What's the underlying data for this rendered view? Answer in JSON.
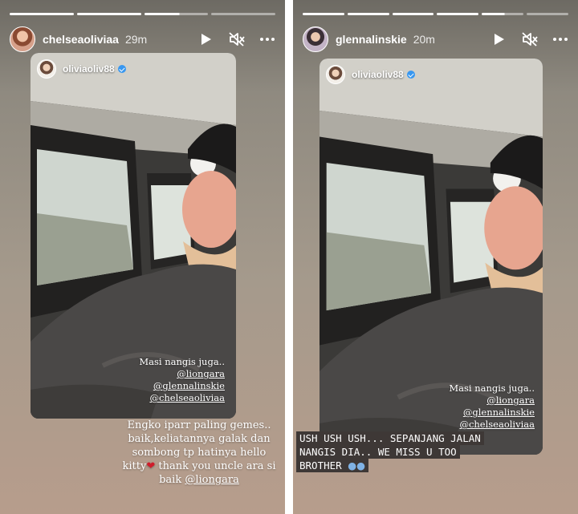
{
  "left_story": {
    "username": "chelseaoliviaa",
    "time": "29m",
    "mention": {
      "username": "oliviaoliv88"
    },
    "photo_caption": {
      "text": "Masi nangis juga..",
      "tags": [
        "@liongara",
        "@glennalinskie",
        "@chelseaoliviaa"
      ]
    },
    "bottom_caption": {
      "line1": "Engko iparr paling gemes..",
      "line2": "baik,keliatannya galak dan",
      "line3": "sombong tp hatinya hello",
      "line4_a": "kitty",
      "line4_b": " thank you uncle ara si",
      "line5_a": "baik ",
      "line5_tag": "@liongara"
    }
  },
  "right_story": {
    "username": "glennalinskie",
    "time": "20m",
    "mention": {
      "username": "oliviaoliv88"
    },
    "photo_caption": {
      "text": "Masi nangis juga..",
      "tags": [
        "@liongara",
        "@glennalinskie",
        "@chelseaoliviaa"
      ]
    },
    "overlay_text": {
      "line1": "USH USH USH... SEPANJANG JALAN",
      "line2": "NANGIS DIA.. WE MISS U TOO",
      "line3": "BROTHER"
    }
  },
  "icons": {
    "play": "play-icon",
    "mute": "speaker-muted-icon",
    "more": "more-options-icon",
    "heart": "red-heart-emoji",
    "people": "people-emoji",
    "verified": "verified-badge-icon"
  },
  "colors": {
    "heart": "#d01c2b",
    "verified": "#3897f0",
    "text_box": "#3e3836"
  }
}
